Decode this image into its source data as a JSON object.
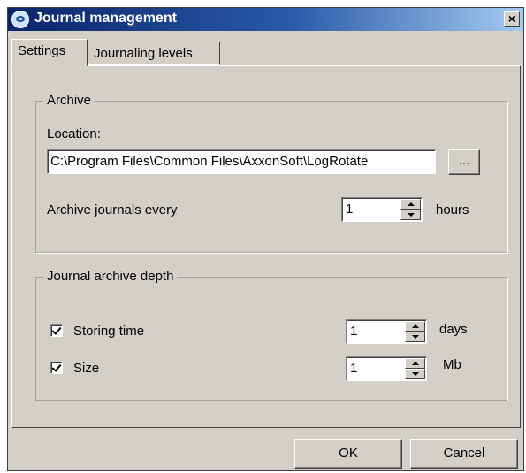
{
  "window": {
    "title": "Journal management",
    "icon": "app-icon",
    "close_label": "×"
  },
  "tabs": [
    {
      "label": "Settings",
      "active": true
    },
    {
      "label": "Journaling levels",
      "active": false
    }
  ],
  "archive": {
    "legend": "Archive",
    "location_label": "Location:",
    "location_value": "C:\\Program Files\\Common Files\\AxxonSoft\\LogRotate",
    "browse_label": "...",
    "every_label": "Archive journals every",
    "every_value": "1",
    "every_unit": "hours"
  },
  "depth": {
    "legend": "Journal archive depth",
    "storing_time": {
      "label": "Storing time",
      "checked": true,
      "value": "1",
      "unit": "days"
    },
    "size": {
      "label": "Size",
      "checked": true,
      "value": "1",
      "unit": "Mb"
    }
  },
  "buttons": {
    "ok": "OK",
    "cancel": "Cancel"
  }
}
